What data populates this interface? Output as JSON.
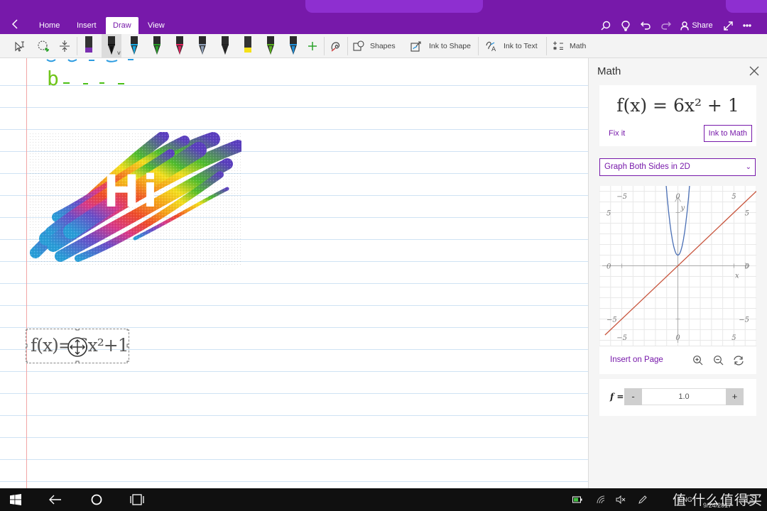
{
  "ribbon": {
    "tabs": [
      {
        "label": "Home",
        "active": false
      },
      {
        "label": "Insert",
        "active": false
      },
      {
        "label": "Draw",
        "active": true
      },
      {
        "label": "View",
        "active": false
      }
    ],
    "share_label": "Share",
    "accent": "#7719aa"
  },
  "toolbar": {
    "pens": [
      {
        "color": "#7a2fb0",
        "kind": "highlighter"
      },
      {
        "color": "#111111",
        "kind": "pen",
        "selected": true
      },
      {
        "color": "#19a8e0",
        "kind": "pen"
      },
      {
        "color": "#2aa12a",
        "kind": "pen"
      },
      {
        "color": "#e0245e",
        "kind": "pen"
      },
      {
        "color": "#8fa0b8",
        "kind": "pen"
      },
      {
        "color": "#222222",
        "kind": "pen"
      },
      {
        "color": "#f5e11a",
        "kind": "highlighter"
      },
      {
        "color": "#5bb11f",
        "kind": "pen"
      },
      {
        "color": "#1f8fd8",
        "kind": "pen"
      }
    ],
    "shapes_label": "Shapes",
    "ink_to_shape_label": "Ink to Shape",
    "ink_to_text_label": "Ink to Text",
    "math_label": "Math"
  },
  "canvas": {
    "ink_letter": "b",
    "sticker_text": "Hi",
    "ink_equation": "f(x)= 6x²+1"
  },
  "math_pane": {
    "title": "Math",
    "equation": "f(x) = 6x² + 1",
    "fix_it_label": "Fix it",
    "ink_to_math_label": "Ink to Math",
    "graph_option": "Graph Both Sides in 2D",
    "insert_on_page_label": "Insert on Page",
    "param_label": "f =",
    "param_value": "1.0",
    "minus_label": "-",
    "plus_label": "+"
  },
  "chart_data": {
    "type": "line",
    "xlim": [
      -7,
      7
    ],
    "ylim": [
      -7.5,
      7.5
    ],
    "xlabel": "x",
    "ylabel": "y",
    "x_ticks": [
      -5,
      0,
      5
    ],
    "y_ticks": [
      -5,
      0,
      5
    ],
    "grid": true,
    "series": [
      {
        "expression": "y = 6x^2 + 1",
        "color": "#4a6fb5"
      },
      {
        "expression": "y = x",
        "color": "#c8553d"
      }
    ]
  },
  "taskbar": {
    "language": "ENG",
    "date": "9/24/2017",
    "notification_count": "1",
    "watermark": "值 什么值得买"
  }
}
